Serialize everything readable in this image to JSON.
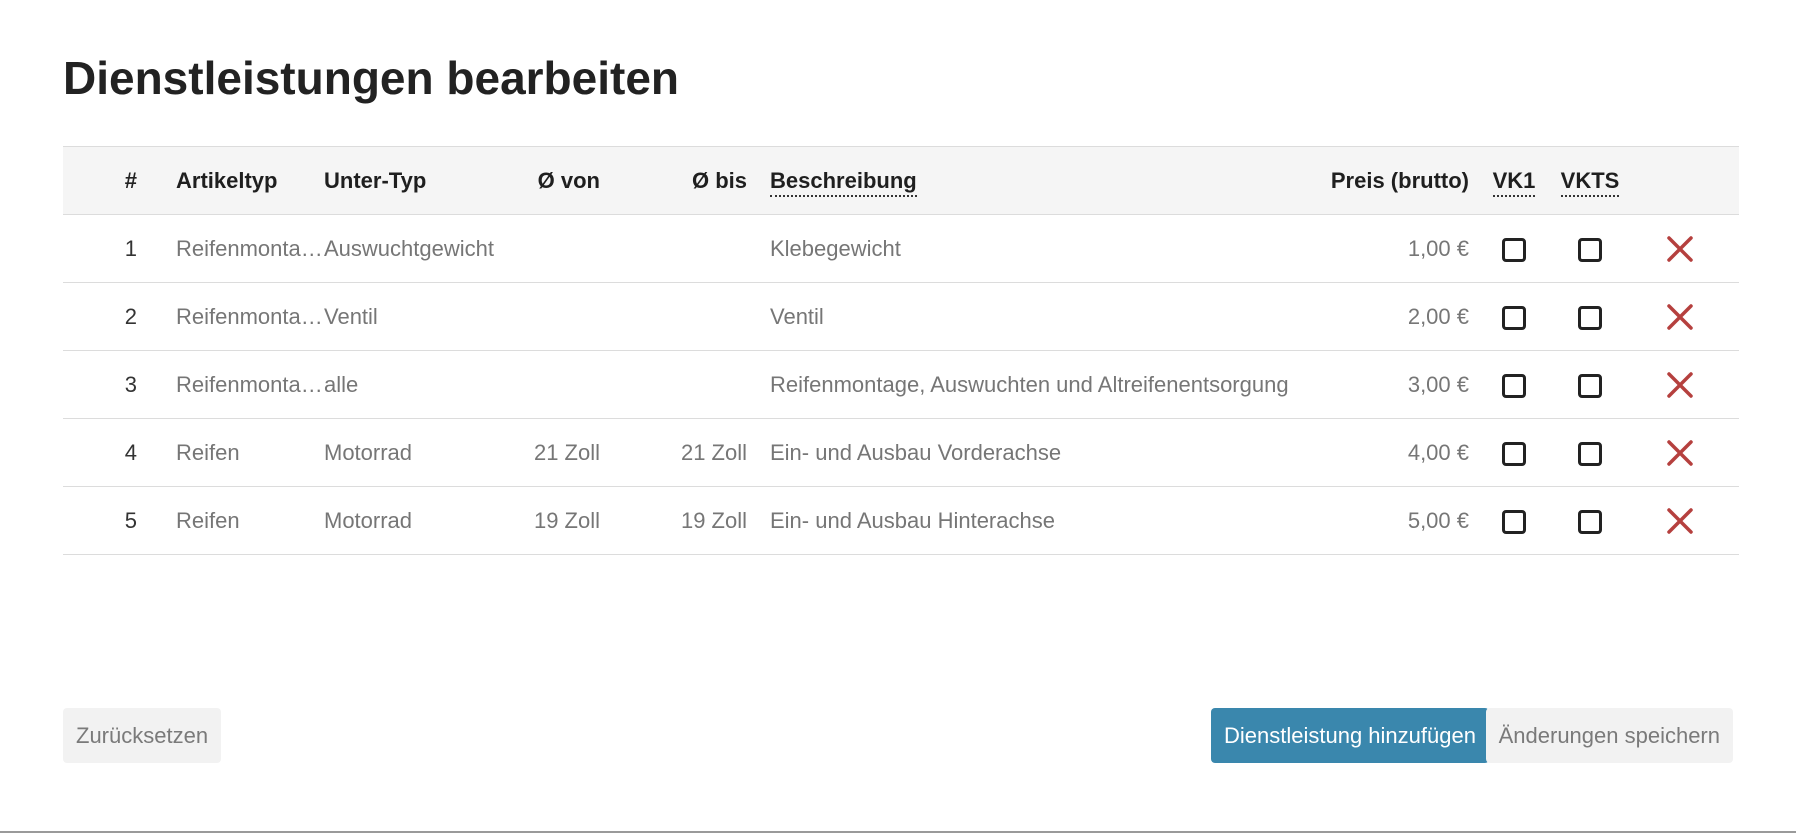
{
  "page": {
    "title": "Dienstleistungen bearbeiten"
  },
  "table": {
    "headers": {
      "index": "#",
      "article_type": "Artikeltyp",
      "sub_type": "Unter-Typ",
      "diameter_from": "Ø von",
      "diameter_to": "Ø bis",
      "description": "Beschreibung",
      "price": "Preis (brutto)",
      "vk1": "VK1",
      "vkts": "VKTS"
    },
    "rows": [
      {
        "index": "1",
        "article_type": "Reifenmontage",
        "sub_type": "Auswuchtgewicht",
        "diameter_from": "",
        "diameter_to": "",
        "description": "Klebegewicht",
        "price": "1,00 €",
        "vk1": false,
        "vkts": false
      },
      {
        "index": "2",
        "article_type": "Reifenmontage",
        "sub_type": "Ventil",
        "diameter_from": "",
        "diameter_to": "",
        "description": "Ventil",
        "price": "2,00 €",
        "vk1": false,
        "vkts": false
      },
      {
        "index": "3",
        "article_type": "Reifenmontage",
        "sub_type": "alle",
        "diameter_from": "",
        "diameter_to": "",
        "description": "Reifenmontage, Auswuchten und Altreifenentsorgung",
        "price": "3,00 €",
        "vk1": false,
        "vkts": false
      },
      {
        "index": "4",
        "article_type": "Reifen",
        "sub_type": "Motorrad",
        "diameter_from": "21 Zoll",
        "diameter_to": "21 Zoll",
        "description": "Ein- und Ausbau Vorderachse",
        "price": "4,00 €",
        "vk1": false,
        "vkts": false
      },
      {
        "index": "5",
        "article_type": "Reifen",
        "sub_type": "Motorrad",
        "diameter_from": "19 Zoll",
        "diameter_to": "19 Zoll",
        "description": "Ein- und Ausbau Hinterachse",
        "price": "5,00 €",
        "vk1": false,
        "vkts": false
      }
    ]
  },
  "footer": {
    "reset_label": "Zurücksetzen",
    "add_label": "Dienstleistung hinzufügen",
    "save_label": "Änderungen speichern"
  },
  "colors": {
    "primary": "#3a87ad",
    "delete": "#b5403e",
    "header_bg": "#f5f5f5",
    "border": "#dcdcdc"
  },
  "icons": {
    "delete": "close-icon",
    "checkbox": "checkbox-unchecked"
  }
}
